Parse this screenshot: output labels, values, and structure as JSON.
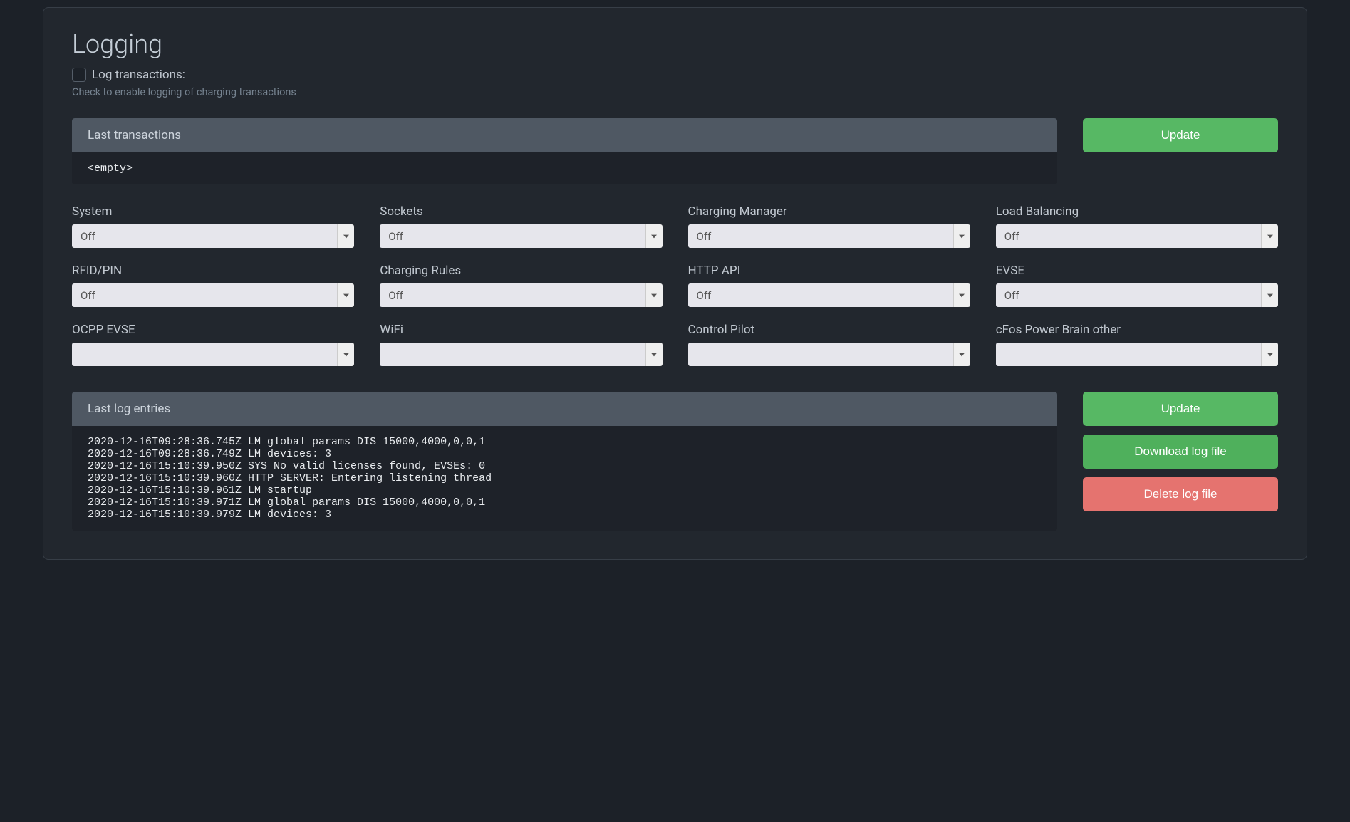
{
  "page_title": "Logging",
  "checkbox_label": "Log transactions:",
  "checkbox_help": "Check to enable logging of charging transactions",
  "last_transactions_header": "Last transactions",
  "last_transactions_body": "<empty>",
  "update_button_1": "Update",
  "selects": [
    {
      "label": "System",
      "value": "Off"
    },
    {
      "label": "Sockets",
      "value": "Off"
    },
    {
      "label": "Charging Manager",
      "value": "Off"
    },
    {
      "label": "Load Balancing",
      "value": "Off"
    },
    {
      "label": "RFID/PIN",
      "value": "Off"
    },
    {
      "label": "Charging Rules",
      "value": "Off"
    },
    {
      "label": "HTTP API",
      "value": "Off"
    },
    {
      "label": "EVSE",
      "value": "Off"
    },
    {
      "label": "OCPP EVSE",
      "value": ""
    },
    {
      "label": "WiFi",
      "value": ""
    },
    {
      "label": "Control Pilot",
      "value": ""
    },
    {
      "label": "cFos Power Brain other",
      "value": ""
    }
  ],
  "last_log_header": "Last log entries",
  "last_log_body": "2020-12-16T09:28:36.745Z LM global params DIS 15000,4000,0,0,1\n2020-12-16T09:28:36.749Z LM devices: 3\n2020-12-16T15:10:39.950Z SYS No valid licenses found, EVSEs: 0\n2020-12-16T15:10:39.960Z HTTP SERVER: Entering listening thread\n2020-12-16T15:10:39.961Z LM startup\n2020-12-16T15:10:39.971Z LM global params DIS 15000,4000,0,0,1\n2020-12-16T15:10:39.979Z LM devices: 3",
  "update_button_2": "Update",
  "download_button": "Download log file",
  "delete_button": "Delete log file"
}
